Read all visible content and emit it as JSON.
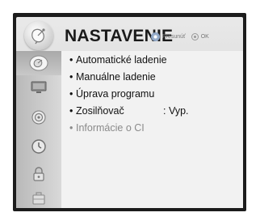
{
  "header": {
    "title": "NASTAVENIE",
    "hint_move": "Presunúť",
    "hint_ok": "OK",
    "header_icon": "satellite-dish-icon"
  },
  "sidebar": {
    "categories": [
      {
        "icon": "satellite-dish-icon",
        "selected": true
      },
      {
        "icon": "monitor-icon",
        "selected": false
      },
      {
        "icon": "speaker-icon",
        "selected": false
      },
      {
        "icon": "clock-icon",
        "selected": false
      },
      {
        "icon": "lock-icon",
        "selected": false
      },
      {
        "icon": "suitcase-icon",
        "selected": false
      }
    ]
  },
  "menu": {
    "items": [
      {
        "label": "Automatické ladenie",
        "value": "",
        "enabled": true
      },
      {
        "label": "Manuálne ladenie",
        "value": "",
        "enabled": true
      },
      {
        "label": "Úprava programu",
        "value": "",
        "enabled": true
      },
      {
        "label": "Zosilňovač",
        "value": ": Vyp.",
        "enabled": true
      },
      {
        "label": "Informácie o CI",
        "value": "",
        "enabled": false
      }
    ]
  },
  "colors": {
    "frame": "#1c1c1c",
    "panel": "#e0e0e0",
    "text": "#111111",
    "disabled_text": "#8a8a8a"
  }
}
